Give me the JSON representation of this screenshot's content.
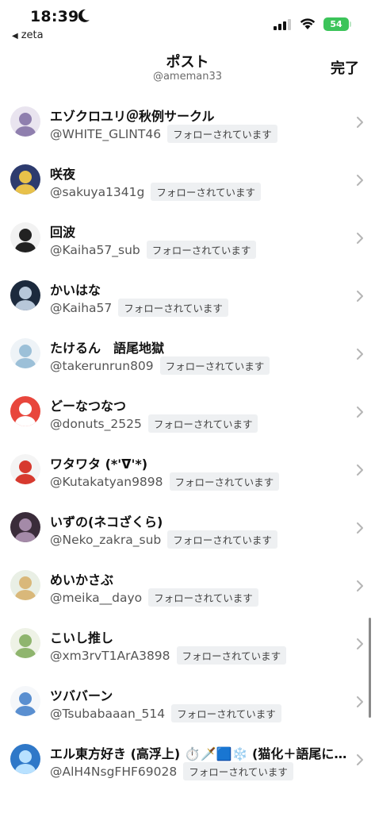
{
  "status_bar": {
    "time": "18:39",
    "back_app": "zeta",
    "battery": "54",
    "battery_color": "#3cc45a"
  },
  "header": {
    "title": "ポスト",
    "subtitle": "@ameman33",
    "done_label": "完了"
  },
  "users": [
    {
      "name": "エゾクロユリ＠秋例サークル",
      "handle": "@WHITE_GLINT46",
      "badge": "フォローされています",
      "avatar_bg": "#e9e4ef",
      "avatar_fg": "#8f7fae"
    },
    {
      "name": "咲夜",
      "handle": "@sakuya1341g",
      "badge": "フォローされています",
      "avatar_bg": "#2d3b6e",
      "avatar_fg": "#e8c14a"
    },
    {
      "name": "回波",
      "handle": "@Kaiha57_sub",
      "badge": "フォローされています",
      "avatar_bg": "#f2f2f2",
      "avatar_fg": "#222222"
    },
    {
      "name": "かいはな",
      "handle": "@Kaiha57",
      "badge": "フォローされています",
      "avatar_bg": "#1c2a3d",
      "avatar_fg": "#b7c7d9"
    },
    {
      "name": "たけるん　語尾地獄",
      "handle": "@takerunrun809",
      "badge": "フォローされています",
      "avatar_bg": "#eef3f7",
      "avatar_fg": "#9cc0d8"
    },
    {
      "name": "どーなつなつ",
      "handle": "@donuts_2525",
      "badge": "フォローされています",
      "avatar_bg": "#e8463c",
      "avatar_fg": "#ffffff"
    },
    {
      "name": "ワタワタ (*'ᐁ'*)",
      "handle": "@Kutakatyan9898",
      "badge": "フォローされています",
      "avatar_bg": "#f4f4f4",
      "avatar_fg": "#d73a2f"
    },
    {
      "name": "いずの(ネコざくら)",
      "handle": "@Neko_zakra_sub",
      "badge": "フォローされています",
      "avatar_bg": "#3a2c3a",
      "avatar_fg": "#a48aa8"
    },
    {
      "name": "めいかさぶ",
      "handle": "@meika__dayo",
      "badge": "フォローされています",
      "avatar_bg": "#e9efe5",
      "avatar_fg": "#d9b87a"
    },
    {
      "name": "こいし推し",
      "handle": "@xm3rvT1ArA3898",
      "badge": "フォローされています",
      "avatar_bg": "#eef2e6",
      "avatar_fg": "#8fb56e"
    },
    {
      "name": "ツババーン",
      "handle": "@Tsubabaaan_514",
      "badge": "フォローされています",
      "avatar_bg": "#f5f7fa",
      "avatar_fg": "#5a8fd0"
    },
    {
      "name": "エル東方好き (高浮上) ⏱️🗡️🟦❄️ (猫化＋語尾に…",
      "handle": "@AlH4NsgFHF69028",
      "badge": "フォローされています",
      "avatar_bg": "#2f78c8",
      "avatar_fg": "#b8e1ff"
    }
  ]
}
